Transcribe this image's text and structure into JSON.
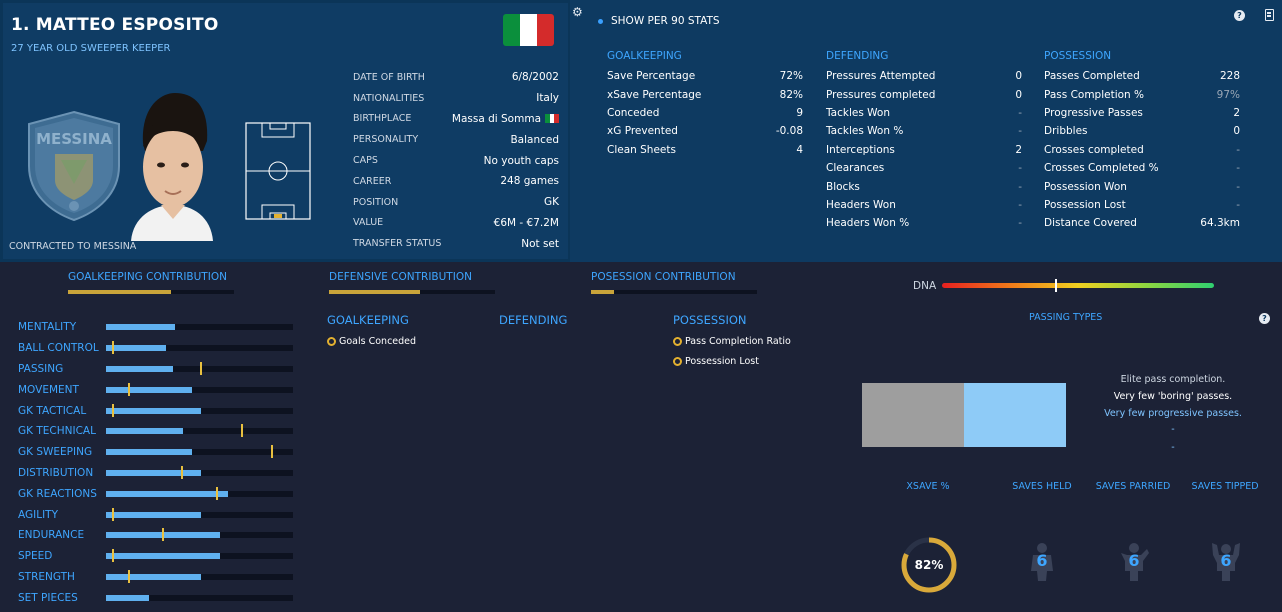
{
  "player": {
    "name": "1. MATTEO ESPOSITO",
    "subtitle": "27 YEAR OLD  SWEEPER KEEPER",
    "contracted": "CONTRACTED TO MESSINA",
    "club_crest_text": "MESSINA",
    "flag_colors": [
      "#0b8f3c",
      "#ffffff",
      "#d42b2b"
    ]
  },
  "info": [
    {
      "label": "DATE OF BIRTH",
      "value": "6/8/2002"
    },
    {
      "label": "NATIONALITIES",
      "value": "Italy"
    },
    {
      "label": "BIRTHPLACE",
      "value": "Massa di Somma"
    },
    {
      "label": "PERSONALITY",
      "value": "Balanced"
    },
    {
      "label": "CAPS",
      "value": "No youth caps"
    },
    {
      "label": "CAREER",
      "value": "248  games"
    },
    {
      "label": "POSITION",
      "value": "GK"
    },
    {
      "label": "VALUE",
      "value": "€6M - €7.2M"
    },
    {
      "label": "TRANSFER STATUS",
      "value": "Not set"
    }
  ],
  "toolbar": {
    "gear_icon": "gear-icon",
    "show_per90": "SHOW PER 90 STATS",
    "help": "?"
  },
  "stats": {
    "goalkeeping": {
      "title": "GOALKEEPING",
      "rows": [
        {
          "label": "Save Percentage",
          "value": "72%"
        },
        {
          "label": "xSave Percentage",
          "value": "82%"
        },
        {
          "label": "Conceded",
          "value": "9"
        },
        {
          "label": "xG Prevented",
          "value": "-0.08"
        },
        {
          "label": "Clean Sheets",
          "value": "4"
        }
      ]
    },
    "defending": {
      "title": "DEFENDING",
      "rows": [
        {
          "label": "Pressures Attempted",
          "value": "0"
        },
        {
          "label": "Pressures completed",
          "value": "0"
        },
        {
          "label": "Tackles Won",
          "value": "-"
        },
        {
          "label": "Tackles Won %",
          "value": "-"
        },
        {
          "label": "Interceptions",
          "value": "2"
        },
        {
          "label": "Clearances",
          "value": "-"
        },
        {
          "label": "Blocks",
          "value": "-"
        },
        {
          "label": "Headers Won",
          "value": "-"
        },
        {
          "label": "Headers Won %",
          "value": "-"
        }
      ]
    },
    "possession": {
      "title": "POSSESSION",
      "rows": [
        {
          "label": "Passes Completed",
          "value": "228"
        },
        {
          "label": "Pass Completion %",
          "value": "97%"
        },
        {
          "label": "Progressive Passes",
          "value": "2"
        },
        {
          "label": "Dribbles",
          "value": "0"
        },
        {
          "label": "Crosses completed",
          "value": "-"
        },
        {
          "label": "Crosses Completed %",
          "value": "-"
        },
        {
          "label": "Possession Won",
          "value": "-"
        },
        {
          "label": "Possession Lost",
          "value": "-"
        },
        {
          "label": "Distance Covered",
          "value": "64.3km"
        }
      ]
    }
  },
  "contributions": [
    {
      "label": "GOALKEEPING CONTRIBUTION",
      "fill": 0.62
    },
    {
      "label": "DEFENSIVE CONTRIBUTION",
      "fill": 0.55
    },
    {
      "label": "POSESSION CONTRIBUTION",
      "fill": 0.14
    }
  ],
  "dna": {
    "label": "DNA",
    "level": 0.42
  },
  "attributes": [
    {
      "label": "MENTALITY",
      "fill": 0.37,
      "tick": null
    },
    {
      "label": "BALL CONTROL",
      "fill": 0.32,
      "tick": 0.03
    },
    {
      "label": "PASSING",
      "fill": 0.36,
      "tick": 0.5
    },
    {
      "label": "MOVEMENT",
      "fill": 0.46,
      "tick": 0.12
    },
    {
      "label": "GK TACTICAL",
      "fill": 0.51,
      "tick": 0.03
    },
    {
      "label": "GK TECHNICAL",
      "fill": 0.41,
      "tick": 0.72
    },
    {
      "label": "GK SWEEPING",
      "fill": 0.46,
      "tick": 0.88
    },
    {
      "label": "DISTRIBUTION",
      "fill": 0.51,
      "tick": 0.4
    },
    {
      "label": "GK REACTIONS",
      "fill": 0.65,
      "tick": 0.59
    },
    {
      "label": "AGILITY",
      "fill": 0.51,
      "tick": 0.03
    },
    {
      "label": "ENDURANCE",
      "fill": 0.61,
      "tick": 0.3
    },
    {
      "label": "SPEED",
      "fill": 0.61,
      "tick": 0.03
    },
    {
      "label": "STRENGTH",
      "fill": 0.51,
      "tick": 0.12
    },
    {
      "label": "SET PIECES",
      "fill": 0.23,
      "tick": null
    }
  ],
  "traits": {
    "goalkeeping": {
      "title": "GOALKEEPING",
      "items": [
        "Goals Conceded"
      ]
    },
    "defending": {
      "title": "DEFENDING",
      "items": []
    },
    "possession": {
      "title": "POSSESSION",
      "items": [
        "Pass Completion Ratio",
        "Possession Lost"
      ]
    }
  },
  "passing": {
    "title": "PASSING TYPES",
    "notes": [
      "Elite pass completion.",
      "Very few 'boring' passes.",
      "Very few progressive passes.",
      "-",
      "-"
    ],
    "split": 0.5
  },
  "saves": {
    "xsave_label": "XSAVE %",
    "xsave_value": "82%",
    "xsave_fraction": 0.82,
    "held_label": "SAVES HELD",
    "held_value": "6",
    "parried_label": "SAVES PARRIED",
    "parried_value": "6",
    "tipped_label": "SAVES TIPPED",
    "tipped_value": "6"
  }
}
